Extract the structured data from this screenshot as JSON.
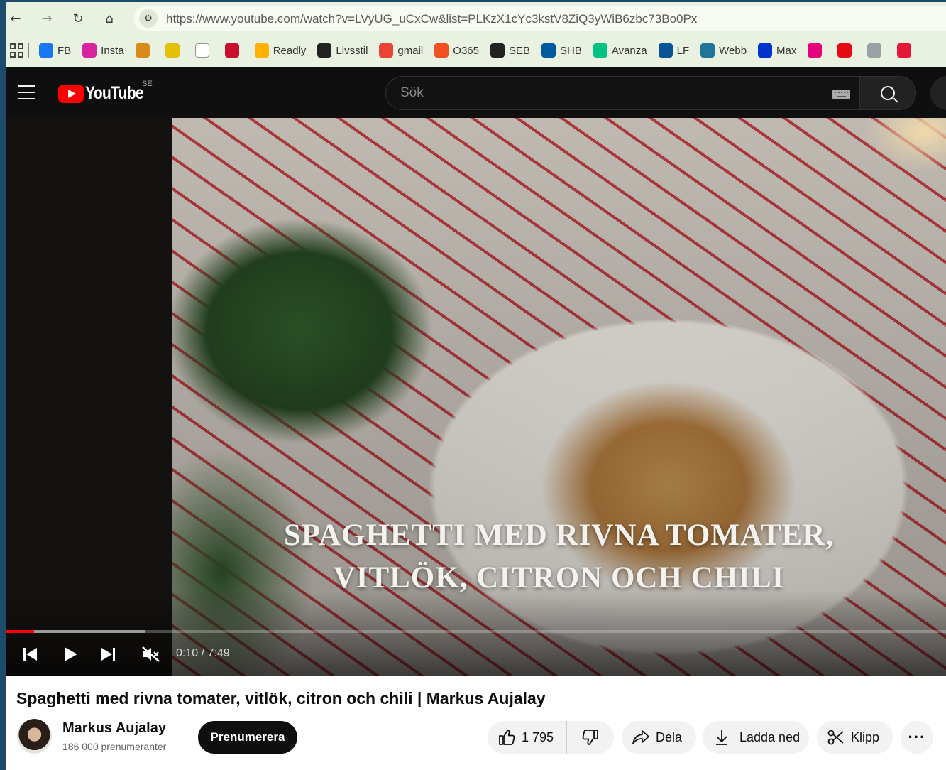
{
  "browser": {
    "url": "https://www.youtube.com/watch?v=LVyUG_uCxCw&list=PLKzX1cYc3kstV8ZiQ3yWiB6zbc73Bo0Px",
    "bookmarks": [
      {
        "label": "FB",
        "icon": "facebook-icon",
        "color": "#1877f2"
      },
      {
        "label": "Insta",
        "icon": "instagram-icon",
        "color": "#d6249f"
      },
      {
        "label": "",
        "icon": "bird-logo-icon",
        "color": "#d88a1c"
      },
      {
        "label": "",
        "icon": "aftonbladet-icon",
        "color": "#e3c000"
      },
      {
        "label": "",
        "icon": "svd-icon",
        "color": "#ffffff"
      },
      {
        "label": "",
        "icon": "dn-icon",
        "color": "#c8102e"
      },
      {
        "label": "Readly",
        "icon": "readly-icon",
        "color": "#ffb100"
      },
      {
        "label": "Livsstil",
        "icon": "livsstil-icon",
        "color": "#222222"
      },
      {
        "label": "gmail",
        "icon": "gmail-icon",
        "color": "#ea4335"
      },
      {
        "label": "O365",
        "icon": "office365-icon",
        "color": "#f25022"
      },
      {
        "label": "SEB",
        "icon": "seb-icon",
        "color": "#222222"
      },
      {
        "label": "SHB",
        "icon": "handelsbanken-icon",
        "color": "#005aa0"
      },
      {
        "label": "Avanza",
        "icon": "avanza-icon",
        "color": "#00c281"
      },
      {
        "label": "LF",
        "icon": "lf-icon",
        "color": "#0b5394"
      },
      {
        "label": "Webb",
        "icon": "wordpress-icon",
        "color": "#21759b"
      },
      {
        "label": "Max",
        "icon": "max-icon",
        "color": "#0033cc"
      },
      {
        "label": "",
        "icon": "arrow-logo-icon",
        "color": "#e6007e"
      },
      {
        "label": "",
        "icon": "netflix-icon",
        "color": "#e50914"
      },
      {
        "label": "",
        "icon": "snl-icon",
        "color": "#9aa0a6"
      },
      {
        "label": "",
        "icon": "a-logo-icon",
        "color": "#e31837"
      }
    ]
  },
  "youtube": {
    "logo_text": "YouTube",
    "country": "SE",
    "search_placeholder": "Sök"
  },
  "player": {
    "overlay_line1": "SPAGHETTI MED RIVNA TOMATER,",
    "overlay_line2": "VITLÖK, CITRON OCH CHILI",
    "time": "0:10 / 7:49",
    "progress_fraction": 0.0302,
    "buffered_fraction": 0.148,
    "progress_color": "#ff0000"
  },
  "video": {
    "title": "Spaghetti med rivna tomater, vitlök, citron och chili | Markus Aujalay",
    "channel": "Markus Aujalay",
    "subscribers": "186 000 prenumeranter",
    "subscribe_label": "Prenumerera",
    "likes": "1 795",
    "share_label": "Dela",
    "download_label": "Ladda ned",
    "clip_label": "Klipp",
    "more_label": "···"
  }
}
